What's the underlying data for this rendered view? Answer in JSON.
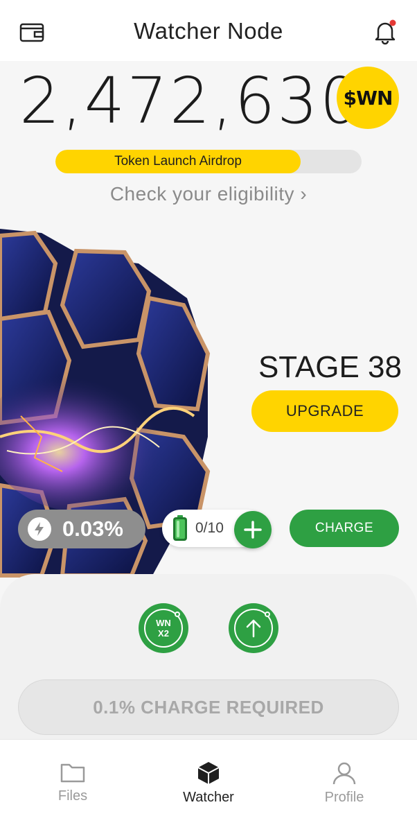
{
  "header": {
    "title": "Watcher Node",
    "wallet_icon": "wallet-icon",
    "bell_icon": "bell-icon",
    "notification_dot_color": "#e53935"
  },
  "balance": {
    "amount": "2,472,630",
    "token_symbol": "$WN"
  },
  "airdrop": {
    "label": "Token Launch Airdrop",
    "progress": 0.8,
    "eligibility_link": "Check your eligibility",
    "chevron": "›"
  },
  "stage": {
    "label": "STAGE 38",
    "upgrade_label": "UPGRADE"
  },
  "stats": {
    "rate": "0.03%",
    "battery": "0/10",
    "charge_label": "CHARGE"
  },
  "boosts": {
    "multiplier_line1": "WN",
    "multiplier_line2": "X2"
  },
  "charge_required": "0.1% CHARGE REQUIRED",
  "nav": {
    "items": [
      {
        "label": "Files",
        "icon": "folder-icon",
        "active": false
      },
      {
        "label": "Watcher",
        "icon": "cube-icon",
        "active": true
      },
      {
        "label": "Profile",
        "icon": "profile-icon",
        "active": false
      }
    ]
  },
  "colors": {
    "accent_yellow": "#ffd400",
    "accent_green": "#2ea043",
    "muted_gray": "#8e8e8e"
  }
}
